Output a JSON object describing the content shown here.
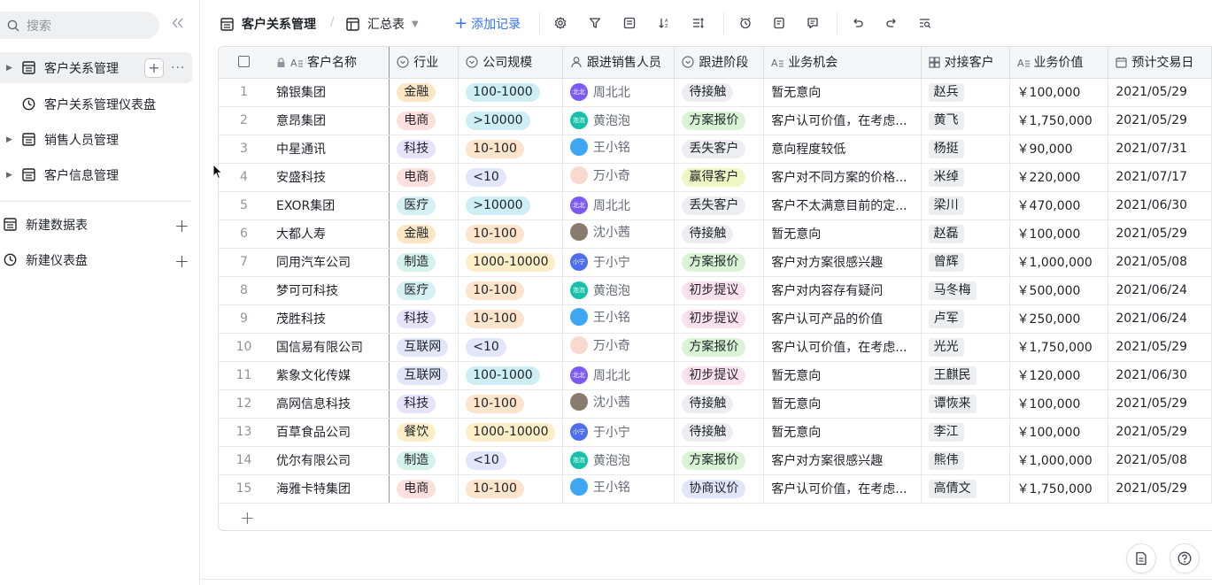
{
  "sidebar": {
    "search_placeholder": "搜索",
    "items": [
      {
        "label": "客户关系管理",
        "icon": "table-icon",
        "active": true
      },
      {
        "label": "客户关系管理仪表盘",
        "icon": "dashboard-icon",
        "active": false
      },
      {
        "label": "销售人员管理",
        "icon": "table-icon",
        "active": false
      },
      {
        "label": "客户信息管理",
        "icon": "table-icon",
        "active": false
      }
    ],
    "new_table": "新建数据表",
    "new_dashboard": "新建仪表盘"
  },
  "toolbar": {
    "table_name": "客户关系管理",
    "separator": "/",
    "view_name": "汇总表",
    "add_record": "添加记录"
  },
  "grid": {
    "columns": [
      {
        "key": "name",
        "label": "客户名称"
      },
      {
        "key": "industry",
        "label": "行业"
      },
      {
        "key": "size",
        "label": "公司规模"
      },
      {
        "key": "sales",
        "label": "跟进销售人员"
      },
      {
        "key": "stage",
        "label": "跟进阶段"
      },
      {
        "key": "opportunity",
        "label": "业务机会"
      },
      {
        "key": "contact",
        "label": "对接客户"
      },
      {
        "key": "value",
        "label": "业务价值"
      },
      {
        "key": "date",
        "label": "预计交易日"
      }
    ],
    "rows": [
      {
        "n": "1",
        "name": "锦银集团",
        "industry": "金融",
        "size": "100-1000",
        "sales": "周北北",
        "stage": "待接触",
        "opportunity": "暂无意向",
        "contact": "赵兵",
        "value": "￥100,000",
        "date": "2021/05/29"
      },
      {
        "n": "2",
        "name": "意昂集团",
        "industry": "电商",
        "size": ">10000",
        "sales": "黄泡泡",
        "stage": "方案报价",
        "opportunity": "客户认可价值，在考虑...",
        "contact": "黄飞",
        "value": "￥1,750,000",
        "date": "2021/05/29"
      },
      {
        "n": "3",
        "name": "中星通讯",
        "industry": "科技",
        "size": "10-100",
        "sales": "王小铭",
        "stage": "丢失客户",
        "opportunity": "意向程度较低",
        "contact": "杨挺",
        "value": "￥90,000",
        "date": "2021/07/31"
      },
      {
        "n": "4",
        "name": "安盛科技",
        "industry": "电商",
        "size": "<10",
        "sales": "万小奇",
        "stage": "赢得客户",
        "opportunity": "客户对不同方案的价格...",
        "contact": "米绰",
        "value": "￥220,000",
        "date": "2021/07/17"
      },
      {
        "n": "5",
        "name": "EXOR集团",
        "industry": "医疗",
        "size": ">10000",
        "sales": "周北北",
        "stage": "丢失客户",
        "opportunity": "客户不太满意目前的定...",
        "contact": "梁川",
        "value": "￥470,000",
        "date": "2021/06/30"
      },
      {
        "n": "6",
        "name": "大都人寿",
        "industry": "金融",
        "size": "10-100",
        "sales": "沈小茜",
        "stage": "待接触",
        "opportunity": "暂无意向",
        "contact": "赵磊",
        "value": "￥100,000",
        "date": "2021/05/29"
      },
      {
        "n": "7",
        "name": "同用汽车公司",
        "industry": "制造",
        "size": "1000-10000",
        "sales": "于小宁",
        "stage": "方案报价",
        "opportunity": "客户对方案很感兴趣",
        "contact": "曾辉",
        "value": "￥1,000,000",
        "date": "2021/05/08"
      },
      {
        "n": "8",
        "name": "梦可可科技",
        "industry": "医疗",
        "size": "10-100",
        "sales": "黄泡泡",
        "stage": "初步提议",
        "opportunity": "客户对内容存有疑问",
        "contact": "马冬梅",
        "value": "￥500,000",
        "date": "2021/06/24"
      },
      {
        "n": "9",
        "name": "茂胜科技",
        "industry": "科技",
        "size": "10-100",
        "sales": "王小铭",
        "stage": "初步提议",
        "opportunity": "客户认可产品的价值",
        "contact": "卢军",
        "value": "￥250,000",
        "date": "2021/06/24"
      },
      {
        "n": "10",
        "name": "国信易有限公司",
        "industry": "互联网",
        "size": "<10",
        "sales": "万小奇",
        "stage": "方案报价",
        "opportunity": "客户认可价值，在考虑...",
        "contact": "光光",
        "value": "￥1,750,000",
        "date": "2021/05/29"
      },
      {
        "n": "11",
        "name": "紫象文化传媒",
        "industry": "互联网",
        "size": "100-1000",
        "sales": "周北北",
        "stage": "初步提议",
        "opportunity": "暂无意向",
        "contact": "王麒民",
        "value": "￥120,000",
        "date": "2021/06/30"
      },
      {
        "n": "12",
        "name": "高网信息科技",
        "industry": "科技",
        "size": "10-100",
        "sales": "沈小茜",
        "stage": "待接触",
        "opportunity": "暂无意向",
        "contact": "谭恢来",
        "value": "￥100,000",
        "date": "2021/05/29"
      },
      {
        "n": "13",
        "name": "百草食品公司",
        "industry": "餐饮",
        "size": "1000-10000",
        "sales": "于小宁",
        "stage": "待接触",
        "opportunity": "暂无意向",
        "contact": "李江",
        "value": "￥100,000",
        "date": "2021/05/29"
      },
      {
        "n": "14",
        "name": "优尔有限公司",
        "industry": "制造",
        "size": "<10",
        "sales": "黄泡泡",
        "stage": "方案报价",
        "opportunity": "客户对方案很感兴趣",
        "contact": "熊伟",
        "value": "￥1,000,000",
        "date": "2021/05/08"
      },
      {
        "n": "15",
        "name": "海雅卡特集团",
        "industry": "电商",
        "size": "10-100",
        "sales": "王小铭",
        "stage": "协商议价",
        "opportunity": "客户认可价值，在考虑...",
        "contact": "高倩文",
        "value": "￥1,750,000",
        "date": "2021/05/29"
      }
    ]
  },
  "avatars": {
    "周北北": {
      "text": "北北",
      "color": "#7a5af8"
    },
    "黄泡泡": {
      "text": "泡泡",
      "color": "#14c0a8"
    },
    "王小铭": {
      "text": "",
      "color": "#3ea6f5"
    },
    "万小奇": {
      "text": "",
      "color": "#f7d9cf"
    },
    "沈小茜": {
      "text": "",
      "color": "#8a7b6f"
    },
    "于小宁": {
      "text": "小宁",
      "color": "#4e6ef2"
    }
  },
  "colors": {
    "industry": {
      "金融": "#fde6c4",
      "电商": "#fde0dd",
      "科技": "#e6e2fb",
      "医疗": "#d6f1f5",
      "制造": "#d4f3ec",
      "互联网": "#e2e6fb",
      "餐饮": "#fdeec7"
    },
    "size": {
      "100-1000": "#cdeef5",
      ">10000": "#cdeef5",
      "10-100": "#fde4cb",
      "<10": "#e2e6fb",
      "1000-10000": "#fdeec7"
    },
    "stage": {
      "待接触": "#eceef1",
      "方案报价": "#d9f5d6",
      "丢失客户": "#eceef1",
      "赢得客户": "#f0f7c4",
      "初步提议": "#fbe1ee",
      "协商议价": "#e2e6fb"
    },
    "contact_bg": "#eceef1",
    "accent": "#3370ff"
  }
}
